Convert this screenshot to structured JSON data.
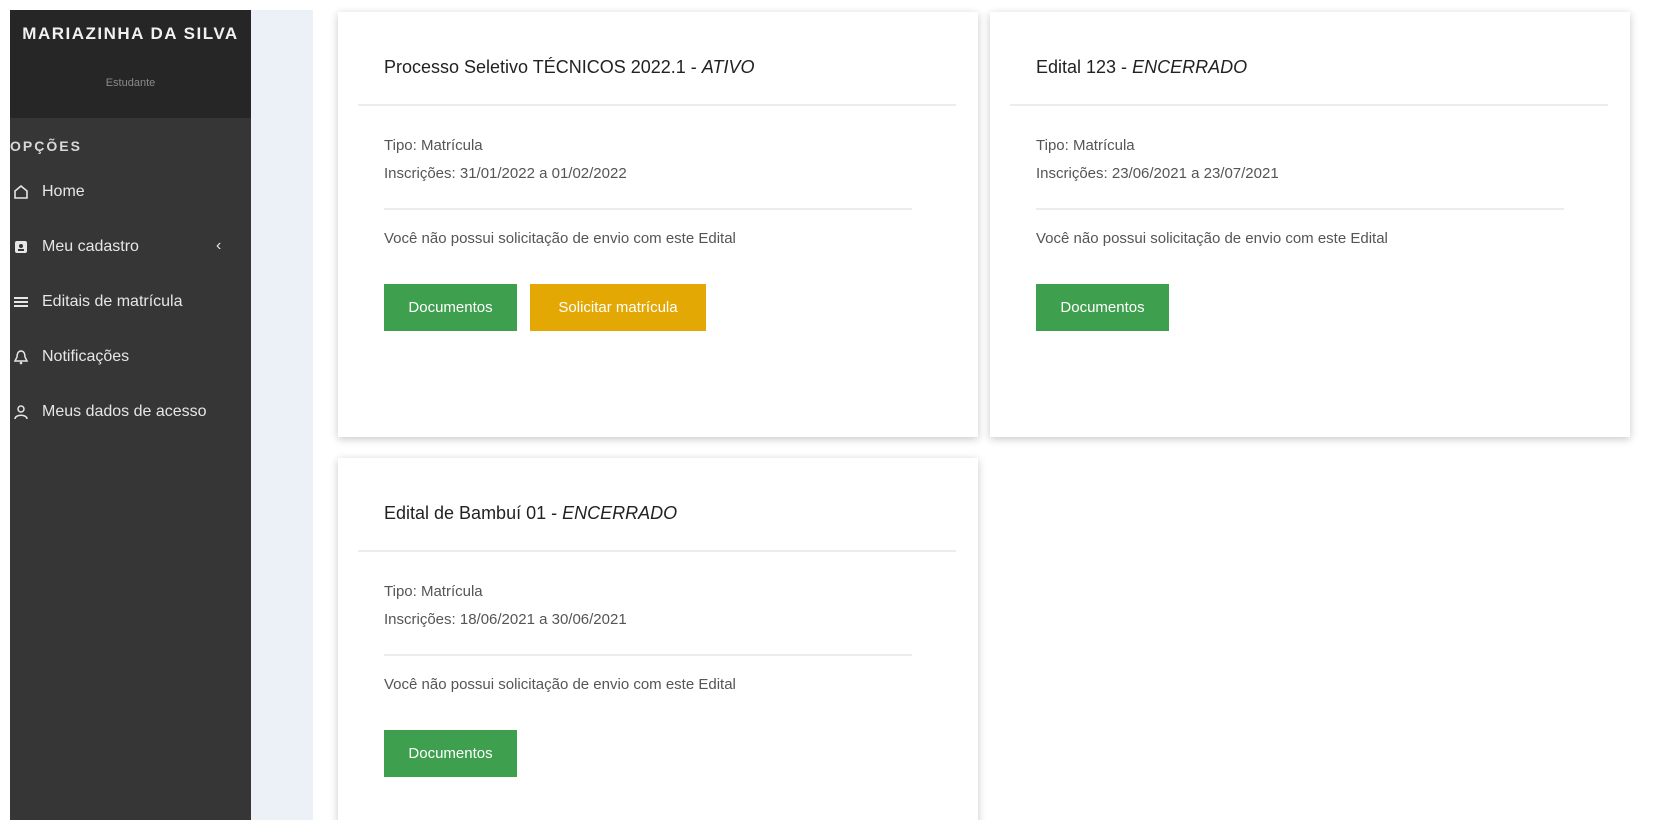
{
  "user": {
    "name": "MARIAZINHA DA SILVA",
    "role": "Estudante"
  },
  "sidebar": {
    "section_title": "OPÇÕES",
    "items": [
      {
        "label": "Home",
        "icon": "home-icon"
      },
      {
        "label": "Meu cadastro",
        "icon": "id-card-icon",
        "has_chevron": true
      },
      {
        "label": "Editais de matrícula",
        "icon": "list-icon"
      },
      {
        "label": "Notificações",
        "icon": "bell-icon"
      },
      {
        "label": "Meus dados de acesso",
        "icon": "user-icon"
      }
    ],
    "chevron": "‹"
  },
  "cards": [
    {
      "title": "Processo Seletivo TÉCNICOS 2022.1 - ",
      "status": "ATIVO",
      "type_line": "Tipo: Matrícula",
      "dates_line": "Inscrições: 31/01/2022 a 01/02/2022",
      "message": "Você não possui solicitação de envio com este Edital",
      "buttons": {
        "documents": "Documentos",
        "request": "Solicitar matrícula"
      }
    },
    {
      "title": "Edital 123 - ",
      "status": "ENCERRADO",
      "type_line": "Tipo: Matrícula",
      "dates_line": "Inscrições: 23/06/2021 a 23/07/2021",
      "message": "Você não possui solicitação de envio com este Edital",
      "buttons": {
        "documents": "Documentos"
      }
    },
    {
      "title": "Edital de Bambuí 01 - ",
      "status": "ENCERRADO",
      "type_line": "Tipo: Matrícula",
      "dates_line": "Inscrições: 18/06/2021 a 30/06/2021",
      "message": "Você não possui solicitação de envio com este Edital",
      "buttons": {
        "documents": "Documentos"
      }
    }
  ],
  "colors": {
    "sidebar_bg": "#363636",
    "user_box_bg": "#262626",
    "gutter_bg": "#ecf1f8",
    "green": "#3ea04e",
    "yellow": "#e3a804"
  }
}
